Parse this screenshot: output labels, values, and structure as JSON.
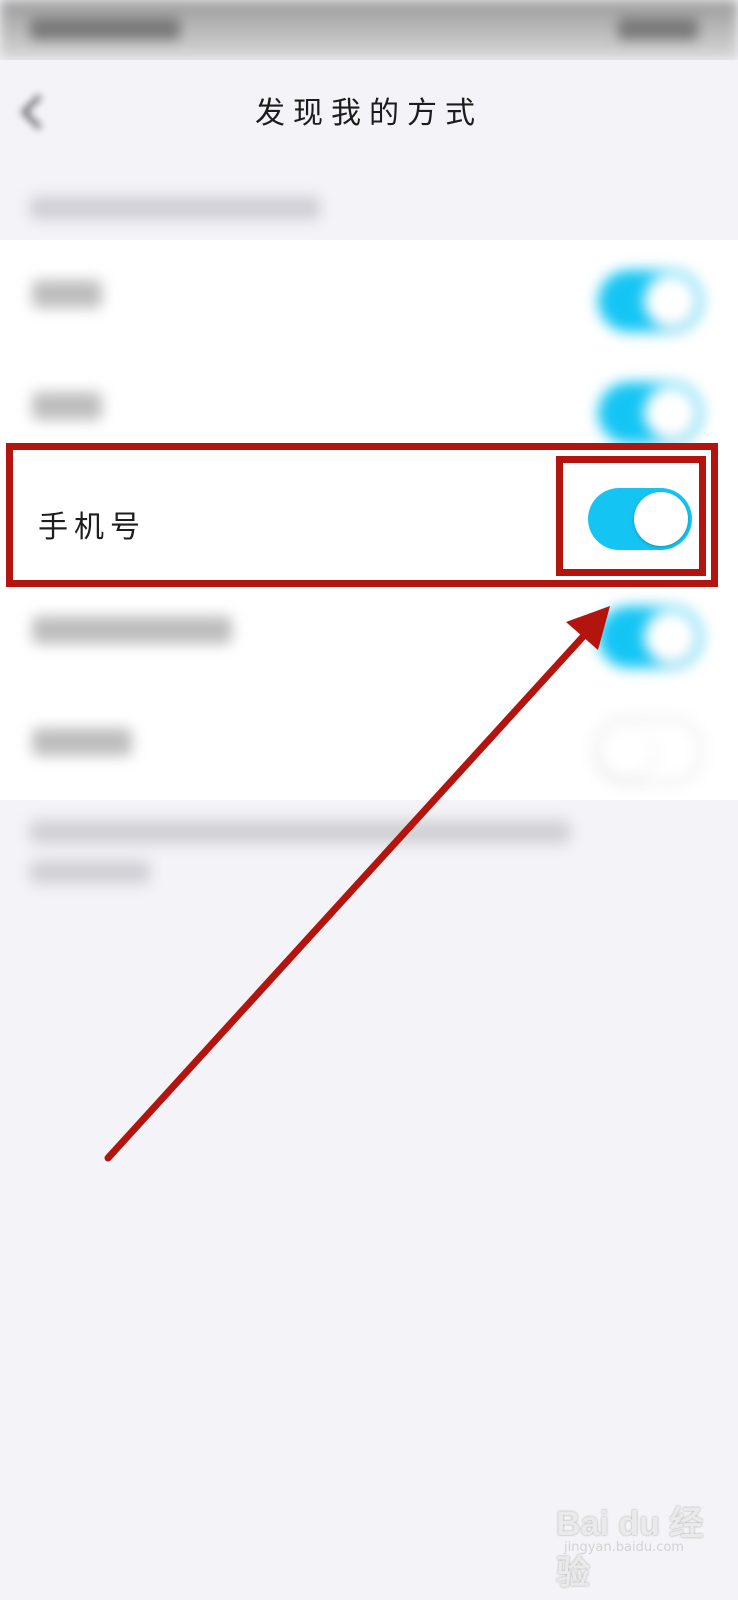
{
  "status_bar": {},
  "header": {
    "title": "发现我的方式"
  },
  "settings": {
    "focused_item": {
      "label": "手机号",
      "toggle_on": true
    }
  },
  "colors": {
    "toggle_on": "#14c5f4",
    "annotation_red": "#b3140d"
  },
  "watermark": {
    "logo": "Bai du 经验",
    "url": "jingyan.baidu.com"
  }
}
